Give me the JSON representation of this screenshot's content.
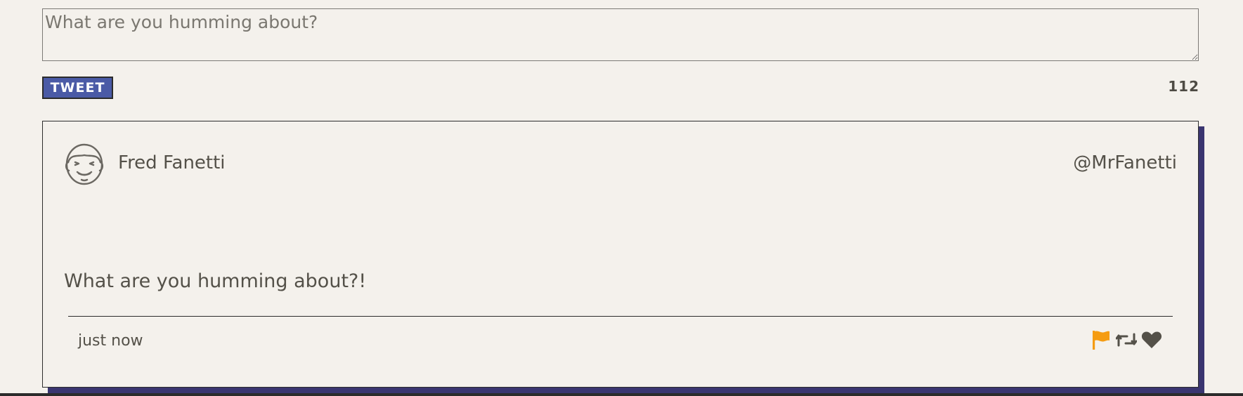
{
  "compose": {
    "placeholder": "What are you humming about?",
    "value": "",
    "tweet_label": "Tweet",
    "char_count": "112"
  },
  "tweet": {
    "author_name": "Fred Fanetti",
    "author_handle": "@MrFanetti",
    "text": "What are you humming about?!",
    "timestamp": "just now",
    "avatar_icon": "smiling-face-icon",
    "actions": [
      {
        "name": "flag",
        "icon": "flag-icon",
        "color": "#f59c12"
      },
      {
        "name": "retweet",
        "icon": "retweet-icon",
        "color": "#545149"
      },
      {
        "name": "like",
        "icon": "heart-icon",
        "color": "#545149"
      }
    ]
  },
  "colors": {
    "background": "#f4f1ec",
    "text": "#545149",
    "button_bg": "#4a5aa6",
    "card_shadow": "#3a3570",
    "flag": "#f59c12"
  }
}
